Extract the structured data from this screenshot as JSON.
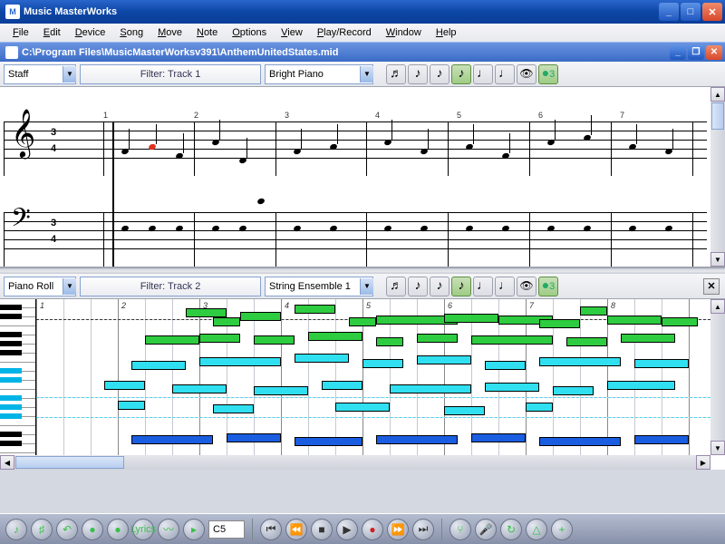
{
  "window": {
    "title": "Music MasterWorks",
    "icon": "M"
  },
  "menu": [
    "File",
    "Edit",
    "Device",
    "Song",
    "Move",
    "Note",
    "Options",
    "View",
    "Play/Record",
    "Window",
    "Help"
  ],
  "doc": {
    "title": "C:\\Program Files\\MusicMasterWorksv391\\AnthemUnitedStates.mid"
  },
  "staff": {
    "view": "Staff",
    "filter": "Filter: Track 1",
    "instrument": "Bright Piano",
    "timesig_top": "3",
    "timesig_bot": "4",
    "measures": [
      "1",
      "2",
      "3",
      "4",
      "5",
      "6",
      "7"
    ]
  },
  "roll": {
    "view": "Piano Roll",
    "filter": "Filter: Track 2",
    "instrument": "String Ensemble 1",
    "measures": [
      "1",
      "2",
      "3",
      "4",
      "5",
      "6",
      "7",
      "8"
    ]
  },
  "transport": {
    "pitch": "C5",
    "lyrics": "Lyrics"
  },
  "notebuttons": [
    "♪",
    "♪",
    "♪",
    "♪",
    "♩",
    "♩",
    "👁",
    "3"
  ]
}
